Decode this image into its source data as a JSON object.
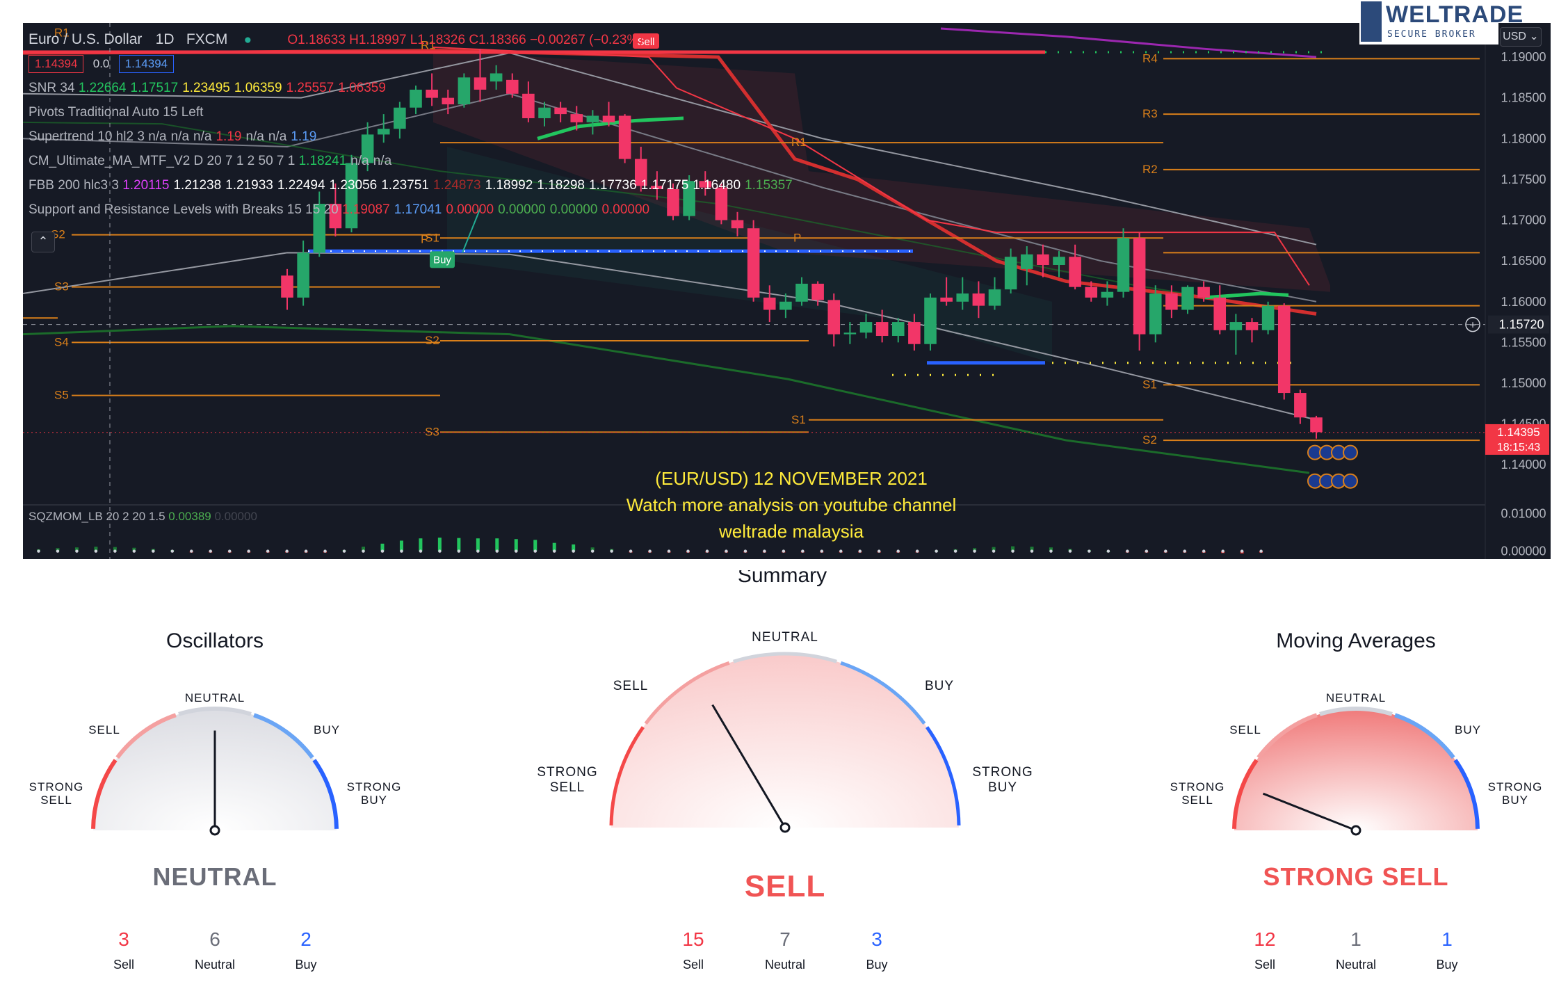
{
  "header": {
    "symbol": "Euro / U.S. Dollar",
    "interval": "1D",
    "exchange": "FXCM",
    "ohlc": {
      "o": "O1.18633",
      "h": "H1.18997",
      "l": "L1.18326",
      "c": "C1.18366",
      "chg": "−0.00267 (−0.23%)"
    },
    "bid": "1.14394",
    "spread": "0.0",
    "ask": "1.14394"
  },
  "indicators": [
    {
      "name": "SNR 34",
      "values": [
        "1.22664",
        "1.17517",
        "1.23495",
        "1.06359",
        "1.25557",
        "1.06359"
      ],
      "colors": [
        "#22c55e",
        "#22c55e",
        "#ffeb3b",
        "#ffeb3b",
        "#f23645",
        "#f23645"
      ]
    },
    {
      "name": "Pivots Traditional Auto 15 Left",
      "values": [],
      "colors": []
    },
    {
      "name": "Supertrend 10 hl2 3",
      "values": [
        "n/a",
        "n/a",
        "n/a",
        "1.19",
        "n/a",
        "n/a",
        "1.19"
      ],
      "colors": [
        "#b2b5be",
        "#b2b5be",
        "#b2b5be",
        "#f23645",
        "#b2b5be",
        "#b2b5be",
        "#5b9cf6"
      ]
    },
    {
      "name": "CM_Ultimate_MA_MTF_V2 D 20 7 1 2 50 7 1",
      "values": [
        "1.18241",
        "n/a",
        "n/a"
      ],
      "colors": [
        "#22c55e",
        "#b2b5be",
        "#b2b5be"
      ]
    },
    {
      "name": "FBB 200 hlc3 3",
      "values": [
        "1.20115",
        "1.21238",
        "1.21933",
        "1.22494",
        "1.23056",
        "1.23751",
        "1.24873",
        "1.18992",
        "1.18298",
        "1.17736",
        "1.17175",
        "1.16480",
        "1.15357"
      ],
      "colors": [
        "#e040fb",
        "#ffffff",
        "#ffffff",
        "#ffffff",
        "#ffffff",
        "#ffffff",
        "#a52a2a",
        "#ffffff",
        "#ffffff",
        "#ffffff",
        "#ffffff",
        "#ffffff",
        "#4caf50"
      ]
    },
    {
      "name": "Support and Resistance Levels with Breaks 15 15 20",
      "values": [
        "1.19087",
        "1.17041",
        "0.00000",
        "0.00000",
        "0.00000",
        "0.00000"
      ],
      "colors": [
        "#f23645",
        "#5b9cf6",
        "#f23645",
        "#4caf50",
        "#4caf50",
        "#f23645"
      ]
    }
  ],
  "sqzmom": {
    "name": "SQZMOM_LB 20 2 20 1.5",
    "value1": "0.00389",
    "value2": "0.00000"
  },
  "price_axis": {
    "currency": "USD",
    "ticks": [
      "1.19000",
      "1.18500",
      "1.18000",
      "1.17500",
      "1.17000",
      "1.16500",
      "1.16000",
      "1.15500",
      "1.15000",
      "1.14500",
      "1.14000"
    ],
    "crosshair": "1.15720",
    "last_price": "1.14395",
    "countdown": "18:15:43",
    "sqz_ticks": [
      "0.01000",
      "0.00000"
    ]
  },
  "annotation": [
    "(EUR/USD) 12 NOVEMBER 2021",
    "Watch more analysis on youtube channel",
    "weltrade malaysia"
  ],
  "signals": {
    "sell": "Sell",
    "buy": "Buy"
  },
  "pivot_labels": {
    "left": [
      "R1",
      "S2",
      "S3",
      "S4",
      "S5"
    ],
    "mid": [
      "R1",
      "P",
      "S1",
      "S2",
      "S3"
    ],
    "right_mid": [
      "R1",
      "P",
      "S1"
    ],
    "right": [
      "R4",
      "R3",
      "R2",
      "S1",
      "S2"
    ]
  },
  "logo": {
    "name": "WELTRADE",
    "tagline": "SECURE BROKER"
  },
  "summary": {
    "title": "Summary",
    "gauges": [
      {
        "title": "Oscillators",
        "verdict": "NEUTRAL",
        "verdict_color": "#6a6d78",
        "labels": {
          "strong_sell": [
            "STRONG",
            "SELL"
          ],
          "sell": "SELL",
          "neutral": "NEUTRAL",
          "buy": "BUY",
          "strong_buy": [
            "STRONG",
            "BUY"
          ]
        },
        "needle_fraction": 0.5,
        "counts": [
          {
            "value": "3",
            "label": "Sell",
            "color": "#f23645"
          },
          {
            "value": "6",
            "label": "Neutral",
            "color": "#6a6d78"
          },
          {
            "value": "2",
            "label": "Buy",
            "color": "#2962ff"
          }
        ]
      },
      {
        "title": "",
        "verdict": "SELL",
        "verdict_color": "#f05454",
        "labels": {
          "strong_sell": [
            "STRONG",
            "SELL"
          ],
          "sell": "SELL",
          "neutral": "NEUTRAL",
          "buy": "BUY",
          "strong_buy": [
            "STRONG",
            "BUY"
          ]
        },
        "needle_fraction": 0.33,
        "counts": [
          {
            "value": "15",
            "label": "Sell",
            "color": "#f23645"
          },
          {
            "value": "7",
            "label": "Neutral",
            "color": "#6a6d78"
          },
          {
            "value": "3",
            "label": "Buy",
            "color": "#2962ff"
          }
        ]
      },
      {
        "title": "Moving Averages",
        "verdict": "STRONG SELL",
        "verdict_color": "#f05454",
        "labels": {
          "strong_sell": [
            "STRONG",
            "SELL"
          ],
          "sell": "SELL",
          "neutral": "NEUTRAL",
          "buy": "BUY",
          "strong_buy": [
            "STRONG",
            "BUY"
          ]
        },
        "needle_fraction": 0.12,
        "counts": [
          {
            "value": "12",
            "label": "Sell",
            "color": "#f23645"
          },
          {
            "value": "1",
            "label": "Neutral",
            "color": "#6a6d78"
          },
          {
            "value": "1",
            "label": "Buy",
            "color": "#2962ff"
          }
        ]
      }
    ]
  },
  "chart_data": {
    "type": "candlestick",
    "title": "Euro / U.S. Dollar",
    "ylim": [
      1.1355,
      1.1935
    ],
    "candles": [
      {
        "o": 1.1632,
        "h": 1.164,
        "l": 1.159,
        "c": 1.1605
      },
      {
        "o": 1.1605,
        "h": 1.1675,
        "l": 1.1595,
        "c": 1.166
      },
      {
        "o": 1.166,
        "h": 1.1735,
        "l": 1.1655,
        "c": 1.172
      },
      {
        "o": 1.172,
        "h": 1.1745,
        "l": 1.168,
        "c": 1.169
      },
      {
        "o": 1.169,
        "h": 1.178,
        "l": 1.1685,
        "c": 1.177
      },
      {
        "o": 1.177,
        "h": 1.182,
        "l": 1.176,
        "c": 1.1805
      },
      {
        "o": 1.1805,
        "h": 1.183,
        "l": 1.1795,
        "c": 1.1812
      },
      {
        "o": 1.1812,
        "h": 1.1845,
        "l": 1.18,
        "c": 1.1838
      },
      {
        "o": 1.1838,
        "h": 1.1865,
        "l": 1.183,
        "c": 1.186
      },
      {
        "o": 1.186,
        "h": 1.188,
        "l": 1.184,
        "c": 1.185
      },
      {
        "o": 1.185,
        "h": 1.186,
        "l": 1.183,
        "c": 1.1842
      },
      {
        "o": 1.1842,
        "h": 1.188,
        "l": 1.1838,
        "c": 1.1875
      },
      {
        "o": 1.1875,
        "h": 1.191,
        "l": 1.1845,
        "c": 1.186
      },
      {
        "o": 1.187,
        "h": 1.189,
        "l": 1.186,
        "c": 1.188
      },
      {
        "o": 1.1872,
        "h": 1.188,
        "l": 1.185,
        "c": 1.1855
      },
      {
        "o": 1.1855,
        "h": 1.187,
        "l": 1.182,
        "c": 1.1825
      },
      {
        "o": 1.1825,
        "h": 1.1845,
        "l": 1.1815,
        "c": 1.1838
      },
      {
        "o": 1.1838,
        "h": 1.1845,
        "l": 1.182,
        "c": 1.183
      },
      {
        "o": 1.183,
        "h": 1.184,
        "l": 1.181,
        "c": 1.182
      },
      {
        "o": 1.182,
        "h": 1.1835,
        "l": 1.1805,
        "c": 1.1828
      },
      {
        "o": 1.1828,
        "h": 1.1845,
        "l": 1.1815,
        "c": 1.182
      },
      {
        "o": 1.1828,
        "h": 1.183,
        "l": 1.177,
        "c": 1.1775
      },
      {
        "o": 1.1775,
        "h": 1.179,
        "l": 1.1735,
        "c": 1.1742
      },
      {
        "o": 1.1742,
        "h": 1.176,
        "l": 1.1725,
        "c": 1.1738
      },
      {
        "o": 1.1738,
        "h": 1.1745,
        "l": 1.17,
        "c": 1.1705
      },
      {
        "o": 1.1705,
        "h": 1.1755,
        "l": 1.17,
        "c": 1.1748
      },
      {
        "o": 1.1748,
        "h": 1.176,
        "l": 1.173,
        "c": 1.174
      },
      {
        "o": 1.174,
        "h": 1.1745,
        "l": 1.1695,
        "c": 1.17
      },
      {
        "o": 1.17,
        "h": 1.171,
        "l": 1.168,
        "c": 1.169
      },
      {
        "o": 1.169,
        "h": 1.17,
        "l": 1.16,
        "c": 1.1605
      },
      {
        "o": 1.1605,
        "h": 1.162,
        "l": 1.1575,
        "c": 1.159
      },
      {
        "o": 1.159,
        "h": 1.161,
        "l": 1.158,
        "c": 1.16
      },
      {
        "o": 1.16,
        "h": 1.163,
        "l": 1.1595,
        "c": 1.1622
      },
      {
        "o": 1.1622,
        "h": 1.1625,
        "l": 1.1595,
        "c": 1.1602
      },
      {
        "o": 1.1602,
        "h": 1.161,
        "l": 1.1545,
        "c": 1.156
      },
      {
        "o": 1.156,
        "h": 1.1575,
        "l": 1.1548,
        "c": 1.1562
      },
      {
        "o": 1.1562,
        "h": 1.1585,
        "l": 1.1555,
        "c": 1.1575
      },
      {
        "o": 1.1575,
        "h": 1.159,
        "l": 1.155,
        "c": 1.1558
      },
      {
        "o": 1.1558,
        "h": 1.158,
        "l": 1.155,
        "c": 1.1575
      },
      {
        "o": 1.1575,
        "h": 1.1585,
        "l": 1.154,
        "c": 1.1548
      },
      {
        "o": 1.1548,
        "h": 1.161,
        "l": 1.154,
        "c": 1.1605
      },
      {
        "o": 1.1605,
        "h": 1.163,
        "l": 1.1595,
        "c": 1.16
      },
      {
        "o": 1.16,
        "h": 1.163,
        "l": 1.159,
        "c": 1.161
      },
      {
        "o": 1.161,
        "h": 1.1625,
        "l": 1.158,
        "c": 1.1595
      },
      {
        "o": 1.1595,
        "h": 1.163,
        "l": 1.159,
        "c": 1.1615
      },
      {
        "o": 1.1615,
        "h": 1.1665,
        "l": 1.161,
        "c": 1.1655
      },
      {
        "o": 1.164,
        "h": 1.1668,
        "l": 1.162,
        "c": 1.1658
      },
      {
        "o": 1.1658,
        "h": 1.167,
        "l": 1.163,
        "c": 1.1645
      },
      {
        "o": 1.1645,
        "h": 1.1662,
        "l": 1.163,
        "c": 1.1655
      },
      {
        "o": 1.1655,
        "h": 1.167,
        "l": 1.1615,
        "c": 1.1618
      },
      {
        "o": 1.1618,
        "h": 1.1625,
        "l": 1.16,
        "c": 1.1605
      },
      {
        "o": 1.1605,
        "h": 1.1625,
        "l": 1.1595,
        "c": 1.1612
      },
      {
        "o": 1.1612,
        "h": 1.169,
        "l": 1.1605,
        "c": 1.1678
      },
      {
        "o": 1.1678,
        "h": 1.1685,
        "l": 1.154,
        "c": 1.156
      },
      {
        "o": 1.156,
        "h": 1.162,
        "l": 1.155,
        "c": 1.161
      },
      {
        "o": 1.161,
        "h": 1.162,
        "l": 1.158,
        "c": 1.159
      },
      {
        "o": 1.159,
        "h": 1.162,
        "l": 1.1585,
        "c": 1.1618
      },
      {
        "o": 1.1618,
        "h": 1.1625,
        "l": 1.16,
        "c": 1.1605
      },
      {
        "o": 1.1605,
        "h": 1.162,
        "l": 1.156,
        "c": 1.1565
      },
      {
        "o": 1.1565,
        "h": 1.1585,
        "l": 1.1535,
        "c": 1.1575
      },
      {
        "o": 1.1575,
        "h": 1.158,
        "l": 1.155,
        "c": 1.1565
      },
      {
        "o": 1.1565,
        "h": 1.16,
        "l": 1.156,
        "c": 1.1595
      },
      {
        "o": 1.1595,
        "h": 1.1598,
        "l": 1.148,
        "c": 1.1488
      },
      {
        "o": 1.1488,
        "h": 1.1492,
        "l": 1.145,
        "c": 1.1458
      },
      {
        "o": 1.1458,
        "h": 1.146,
        "l": 1.1432,
        "c": 1.144
      }
    ],
    "sqz_values": [
      0.0005,
      0.0008,
      0.001,
      0.0012,
      0.0011,
      0.0009,
      0.0006,
      0.0003,
      -0.0002,
      -0.0003,
      -0.0003,
      -0.0002,
      -0.0002,
      -0.0002,
      -0.0003,
      -0.0001,
      0.0003,
      0.0012,
      0.002,
      0.0028,
      0.0034,
      0.0036,
      0.0035,
      0.0034,
      0.0034,
      0.0032,
      0.003,
      0.0022,
      0.0018,
      0.001,
      0.0006,
      -0.0001,
      -0.0002,
      -0.0002,
      -0.0002,
      -0.0002,
      -0.0003,
      -0.0002,
      -0.0002,
      -0.0002,
      -0.0002,
      -0.0001,
      -0.0002,
      -0.0002,
      -0.0002,
      -0.0001,
      -0.0001,
      0.0002,
      0.0005,
      0.0008,
      0.0011,
      0.0013,
      0.0012,
      0.001,
      0.0006,
      0.0003,
      0.0001,
      -0.0001,
      -0.0002,
      -0.0002,
      -0.0003,
      -0.0004,
      -0.0005,
      -0.0006,
      -0.0004
    ],
    "sqz_ylim": [
      -0.001,
      0.011
    ]
  }
}
